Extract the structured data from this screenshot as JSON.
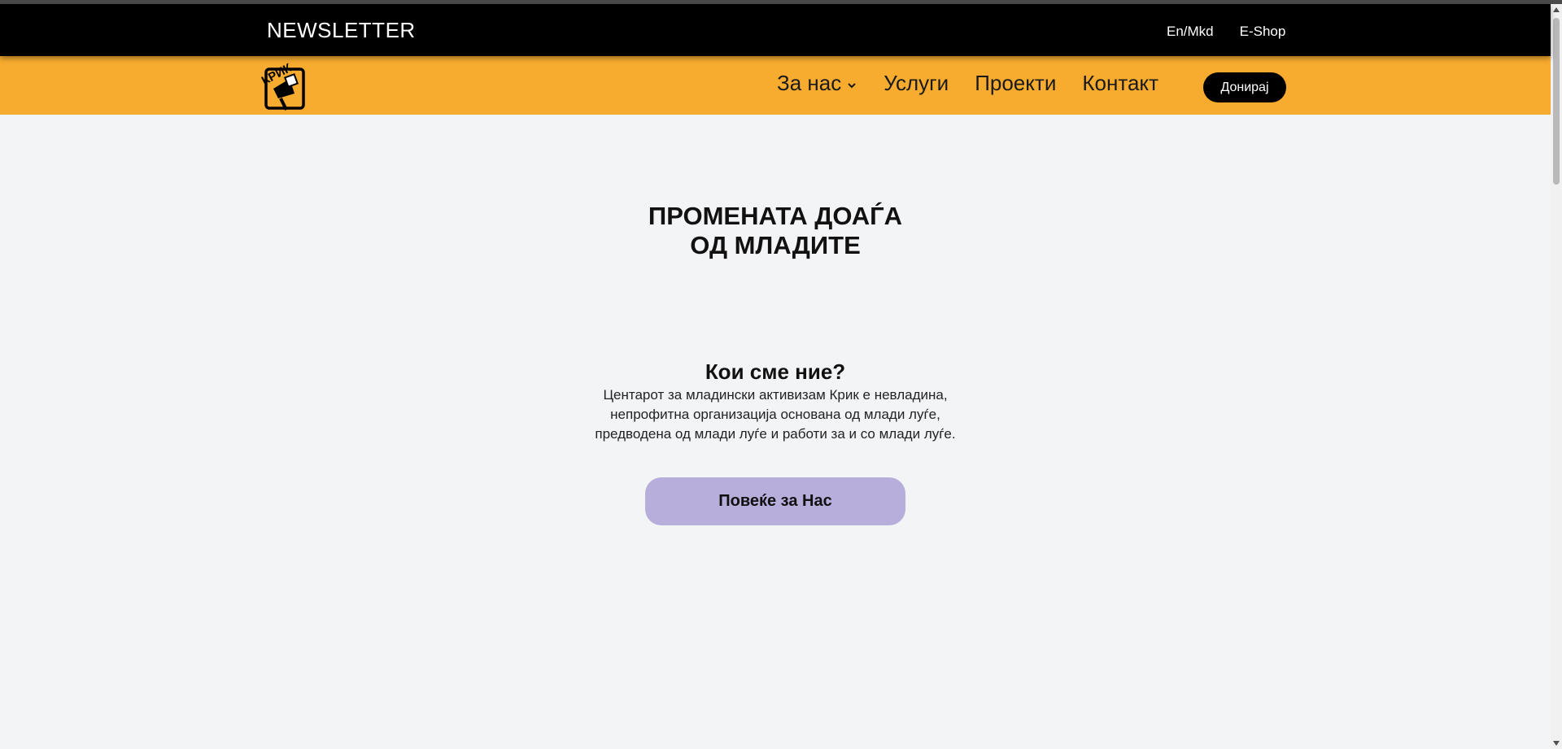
{
  "topbar": {
    "newsletter": "NEWSLETTER",
    "lang_switch": "En/Mkd",
    "shop": "E-Shop"
  },
  "nav": {
    "logo_icon": "megaphone-logo-icon",
    "logo_text": "КРИК",
    "items": [
      {
        "label": "За нас",
        "has_dropdown": true
      },
      {
        "label": "Услуги"
      },
      {
        "label": "Проекти"
      },
      {
        "label": "Контакт"
      }
    ],
    "donate": "Донирај"
  },
  "hero": {
    "title_line1": "ПРОМЕНАТА ДОАЃА",
    "title_line2": "ОД МЛАДИТЕ"
  },
  "about": {
    "heading": "Кои сме ние?",
    "line1": "Центарот за младински активизам Крик е невладина,",
    "line2": "непрофитна организација основана од млади луѓе,",
    "line3": "предводена од млади луѓе и работи за и со млади луѓе.",
    "button": "Повеќе за Нас"
  },
  "colors": {
    "topbar_bg": "#000000",
    "nav_bg": "#f7ab2f",
    "page_bg": "#f3f4f6",
    "donate_bg": "#000000",
    "more_button_bg": "#b7aedb"
  }
}
